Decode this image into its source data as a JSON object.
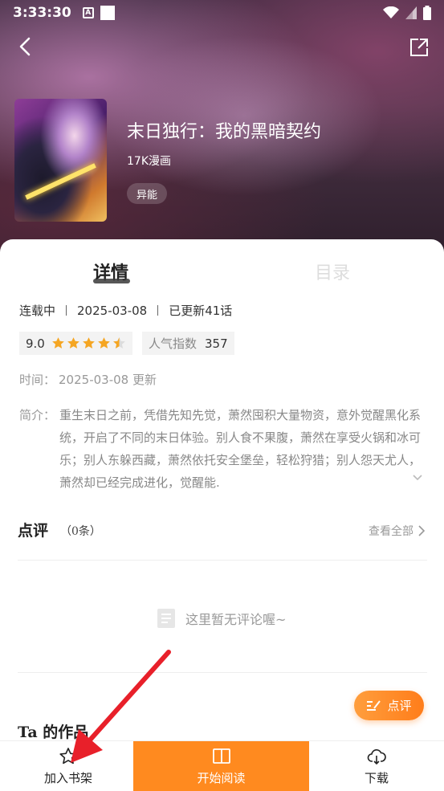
{
  "status_bar": {
    "time": "3:33:30",
    "notif_letter": "A"
  },
  "header": {
    "back_icon": "chevron-left-icon",
    "share_icon": "share-icon"
  },
  "book": {
    "title": "末日独行：我的黑暗契约",
    "source": "17K漫画",
    "tag": "异能"
  },
  "tabs": {
    "detail": "详情",
    "catalog": "目录"
  },
  "meta": {
    "status": "连载中",
    "date": "2025-03-08",
    "updated": "已更新41话"
  },
  "rating": {
    "score": "9.0",
    "stars": 4.5
  },
  "popularity": {
    "label": "人气指数",
    "value": "357"
  },
  "time_row": {
    "label": "时间：",
    "value": "2025-03-08 更新"
  },
  "intro": {
    "label": "简介：",
    "text": "重生末日之前，凭借先知先觉，萧然囤积大量物资，意外觉醒黑化系统，开启了不同的末日体验。别人食不果腹，萧然在享受火锅和冰可乐；别人东躲西藏，萧然依托安全堡垒，轻松狩猎；别人怨天尤人，萧然却已经完成进化，觉醒能."
  },
  "reviews": {
    "title": "点评",
    "count": "（0条）",
    "view_all": "查看全部",
    "empty_text": "这里暂无评论喔~",
    "comment_button": "点评"
  },
  "works": {
    "title": "Ta 的作品"
  },
  "bottom_bar": {
    "shelf": "加入书架",
    "read": "开始阅读",
    "download": "下载"
  },
  "colors": {
    "accent": "#ff8a1f",
    "star": "#f5a623",
    "annotation_arrow": "#e8202a"
  }
}
